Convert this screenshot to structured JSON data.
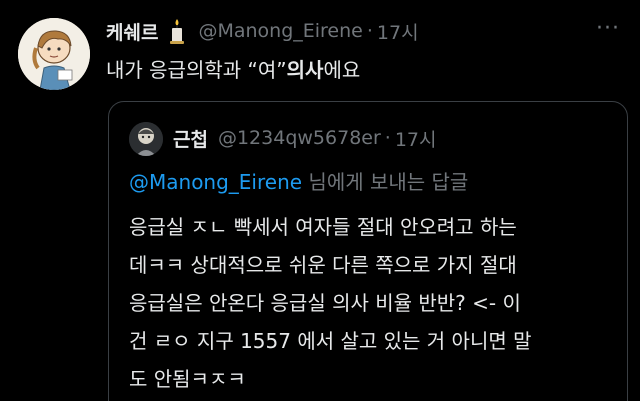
{
  "tweet": {
    "display_name": "케쉐르",
    "handle": "@Manong_Eirene",
    "separator": "·",
    "time": "17시",
    "more": "···",
    "text_plain_1": "내가 응급의학과 “여”",
    "text_bold": "의사",
    "text_plain_2": "에요"
  },
  "quoted": {
    "display_name": "근첩",
    "handle": "@1234qw5678er",
    "separator": "·",
    "time": "17시",
    "reply_mention": "@Manong_Eirene",
    "reply_suffix": " 님에게 보내는 답글",
    "lines": [
      "응급실 ㅈㄴ 빡세서 여자들 절대 안오려고 하는",
      "데ㅋㅋ 상대적으로 쉬운 다른 쪽으로 가지 절대",
      "응급실은 안온다 응급실 의사 비율 반반? <- 이",
      "건 ㄹㅇ 지구 1557 에서 살고 있는 거 아니면 말",
      "도 안됨ㅋㅈㅋ"
    ]
  },
  "icons": {
    "candle": "candle-emoji",
    "more": "more-horizontal-icon"
  }
}
